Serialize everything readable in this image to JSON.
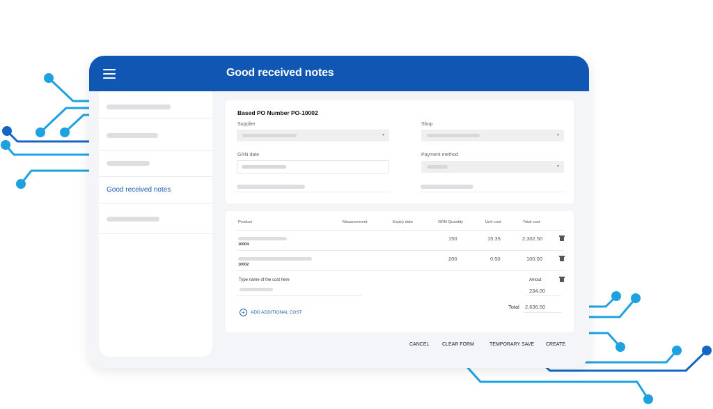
{
  "header": {
    "title": "Good received notes"
  },
  "sidebar": {
    "items": [
      {
        "label": ""
      },
      {
        "label": ""
      },
      {
        "label": ""
      },
      {
        "label": "Good received notes"
      },
      {
        "label": ""
      }
    ]
  },
  "form": {
    "po_title": "Based PO Number PO-10002",
    "supplier_label": "Supplier",
    "shop_label": "Shop",
    "grn_date_label": "GRN date",
    "payment_method_label": "Payment method"
  },
  "table": {
    "headers": [
      "Product",
      "Measurement",
      "Expiry date",
      "GRN Quantity",
      "Unit cost",
      "Total cost"
    ],
    "rows": [
      {
        "code": "10004",
        "quantity": "150",
        "unit_cost": "15.35",
        "total_cost": "2,302.50"
      },
      {
        "code": "10002",
        "quantity": "200",
        "unit_cost": "0.50",
        "total_cost": "100.00"
      }
    ]
  },
  "additional_cost": {
    "name_label": "Type name of the cost here",
    "amount_label": "Amout",
    "amount": "234.00",
    "add_label": "ADD ADDITIONAL COST"
  },
  "totals": {
    "label": "Total",
    "value": "2,636.50"
  },
  "footer": {
    "cancel": "CANCEL",
    "clear_form": "CLEAR FORM",
    "temporary_save": "TEMPORARY SAVE",
    "create": "CREATE"
  },
  "colors": {
    "primary": "#0f57b3",
    "circuit_light": "#1da1e0",
    "circuit_dark": "#1566c4"
  },
  "icons": {
    "menu": "hamburger-menu-icon",
    "dropdown": "chevron-down-icon",
    "delete": "trash-icon",
    "add": "plus-circle-icon"
  }
}
